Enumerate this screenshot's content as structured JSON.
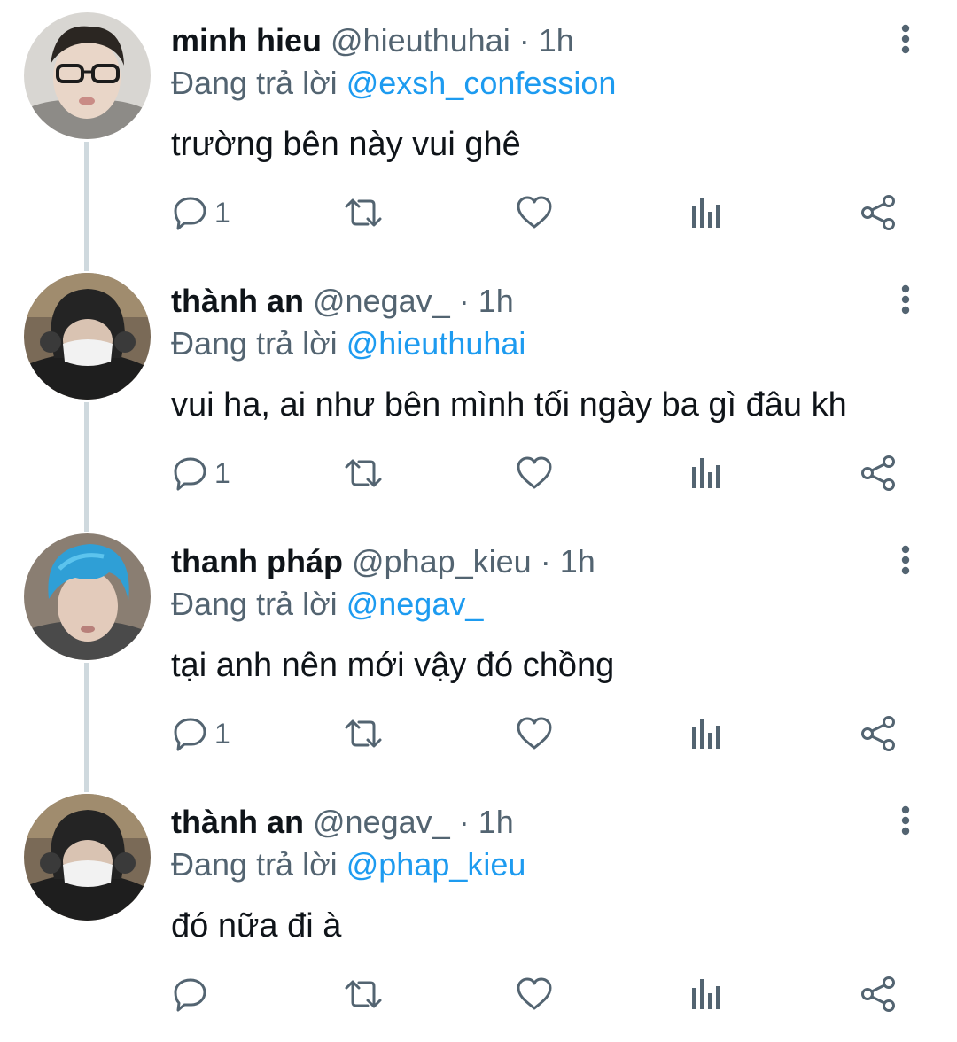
{
  "reply_prefix": "Đang trả lời",
  "tweets": [
    {
      "name": "minh hieu",
      "handle": "@hieuthuhai",
      "sep": "·",
      "time": "1h",
      "replying_to": "@exsh_confession",
      "text": "trường bên này vui ghê",
      "reply_count": "1",
      "avatar": "avatar-glasses"
    },
    {
      "name": "thành an",
      "handle": "@negav_",
      "sep": "·",
      "time": "1h",
      "replying_to": "@hieuthuhai",
      "text": "vui ha, ai như bên mình tối ngày ba gì đâu kh",
      "reply_count": "1",
      "avatar": "avatar-headphones-mask"
    },
    {
      "name": "thanh pháp",
      "handle": "@phap_kieu",
      "sep": "·",
      "time": "1h",
      "replying_to": "@negav_",
      "text": "tại anh nên mới vậy đó chồng",
      "reply_count": "1",
      "avatar": "avatar-blue-hair"
    },
    {
      "name": "thành an",
      "handle": "@negav_",
      "sep": "·",
      "time": "1h",
      "replying_to": "@phap_kieu",
      "text": "đó nữa đi à",
      "reply_count": "",
      "avatar": "avatar-headphones-mask"
    }
  ],
  "icons": {
    "reply": "reply-icon",
    "retweet": "retweet-icon",
    "like": "heart-icon",
    "views": "views-icon",
    "share": "share-icon",
    "more": "more-vertical-icon"
  },
  "colors": {
    "text": "#0f1419",
    "secondary": "#536471",
    "accent": "#1d9bf0",
    "thread_line": "#cfd9de"
  }
}
